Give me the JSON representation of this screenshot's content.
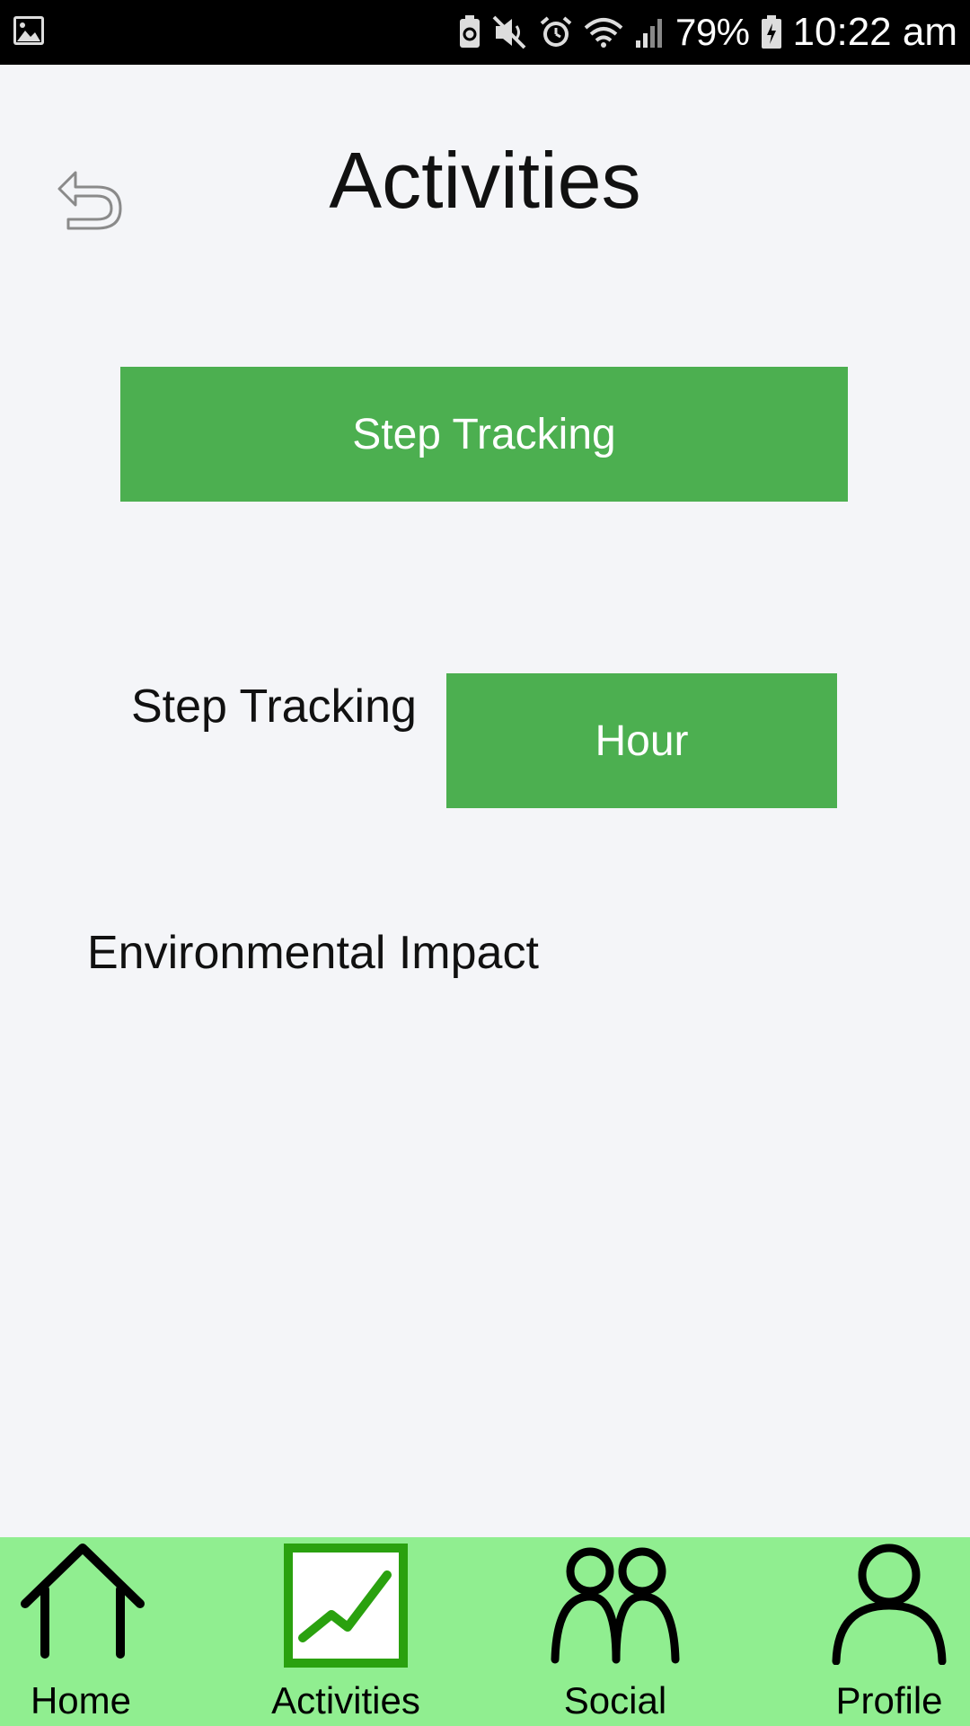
{
  "status_bar": {
    "battery_percent": "79%",
    "time": "10:22 am",
    "icons": [
      "image-icon",
      "recycle-icon",
      "mute-icon",
      "alarm-icon",
      "wifi-icon",
      "signal-icon",
      "battery-icon"
    ]
  },
  "header": {
    "title": "Activities",
    "back_icon": "undo-arrow-icon"
  },
  "main": {
    "step_tracking_button": "Step Tracking",
    "step_tracking_label": "Step Tracking",
    "hour_button": "Hour",
    "environmental_impact_label": "Environmental Impact"
  },
  "bottom_nav": {
    "items": [
      {
        "label": "Home",
        "icon": "house-icon"
      },
      {
        "label": "Activities",
        "icon": "activity-chart-icon",
        "active": true
      },
      {
        "label": "Social",
        "icon": "people-icon"
      },
      {
        "label": "Profile",
        "icon": "person-icon"
      }
    ]
  },
  "colors": {
    "accent_green": "#4caf50",
    "nav_background": "#90ee90",
    "active_icon_green": "#2aa10f",
    "page_background": "#f4f5f8"
  }
}
